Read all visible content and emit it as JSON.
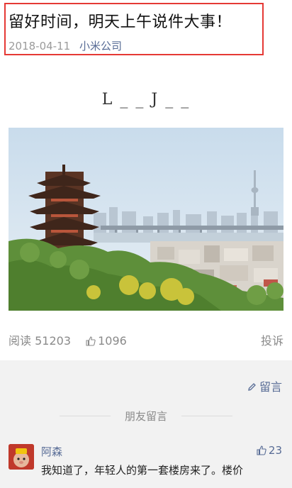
{
  "article": {
    "title": "留好时间，明天上午说件大事！",
    "date": "2018-04-11",
    "author": "小米公司",
    "center_text": "L _ _ J _ _"
  },
  "stats": {
    "read_label": "阅读",
    "read_count": "51203",
    "likes": "1096",
    "report_label": "投诉"
  },
  "comments_section": {
    "write_label": "留言",
    "section_title": "朋友留言",
    "items": [
      {
        "name": "阿森",
        "likes": "23",
        "text": "我知道了，年轻人的第一套楼房来了。楼价"
      }
    ]
  },
  "colors": {
    "highlight_border": "#e53935",
    "link_blue": "#576b95"
  }
}
